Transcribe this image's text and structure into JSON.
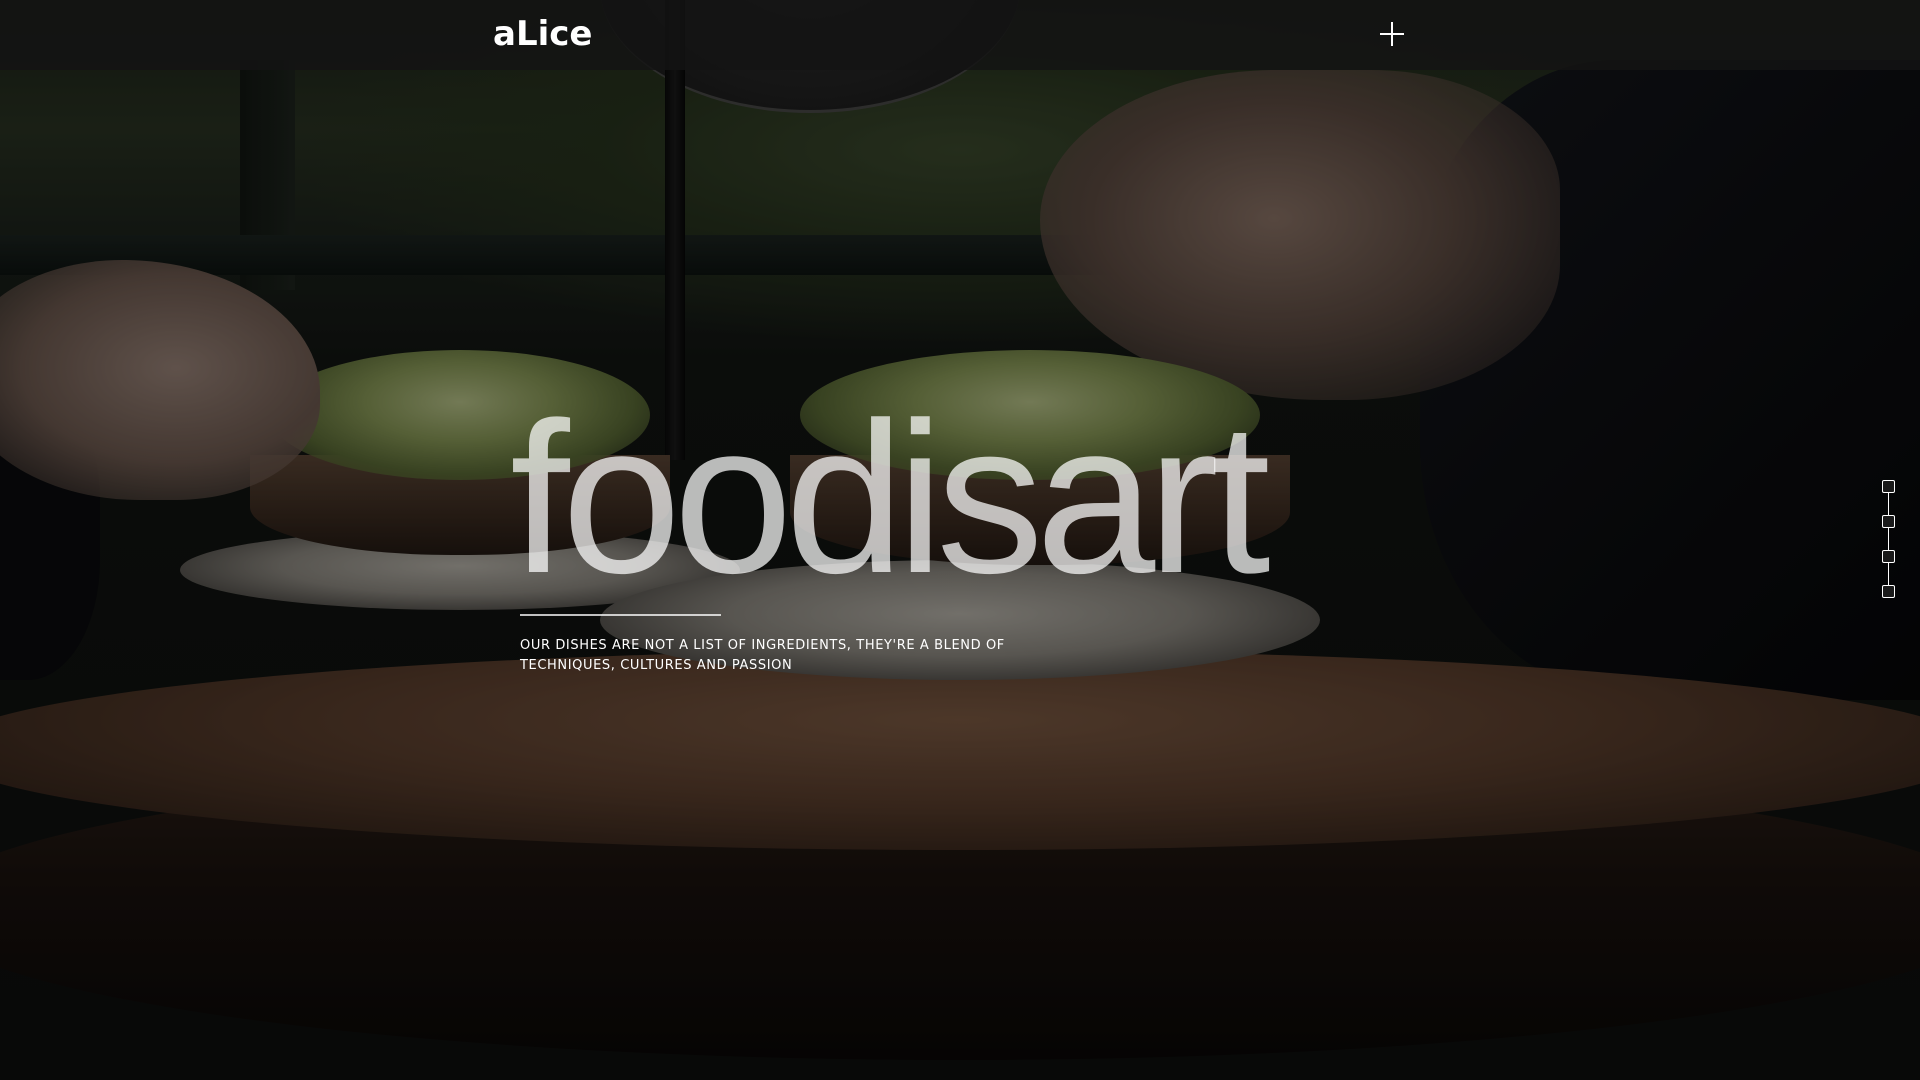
{
  "header": {
    "logo_text": "aLice",
    "menu_icon": "plus-icon"
  },
  "hero": {
    "title": "foodisart",
    "subtitle_line1": "OUR DISHES ARE NOT A LIST OF INGREDIENTS, THEY'RE A BLEND OF",
    "subtitle_line2": "TECHNIQUES, CULTURES AND PASSION"
  },
  "pager": {
    "count": 4,
    "icon": "square-outline-icon"
  },
  "colors": {
    "text": "#ffffff",
    "header_bg": "#141414"
  }
}
